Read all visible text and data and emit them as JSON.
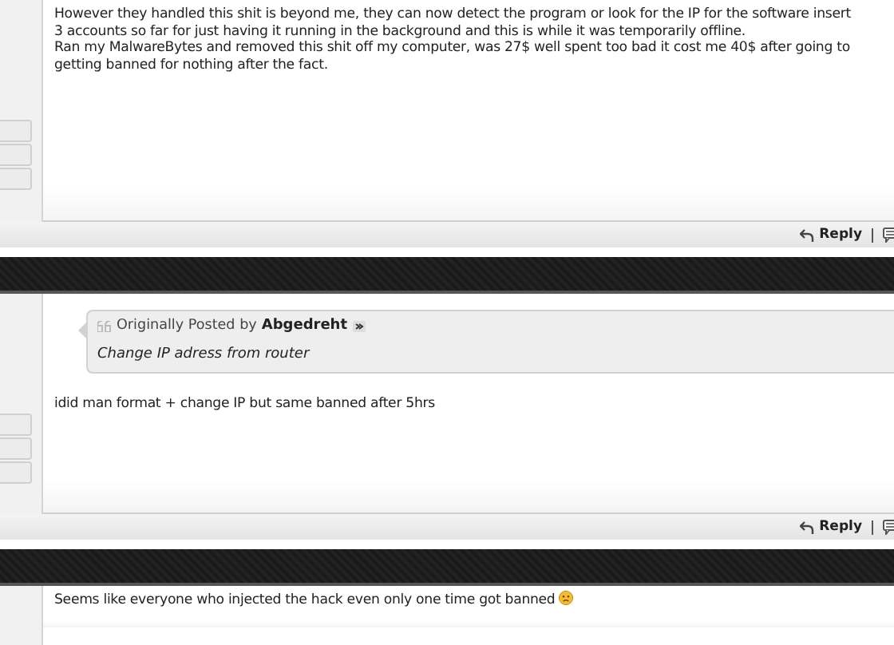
{
  "posts": [
    {
      "lines": [
        "However they handled this shit is beyond me, they can now detect the program or look for the IP for the software insert",
        "3 accounts so far for just having it running in the background and this is while it was temporarily offline.",
        "Ran my MalwareBytes and removed this shit off my computer, was 27$ well spent too bad it cost me 40$ after going to",
        "getting banned for nothing after the fact."
      ],
      "footer": {
        "reply": "Reply"
      }
    },
    {
      "quote": {
        "label": "Originally Posted by",
        "author": "Abgedreht",
        "text": "Change IP adress from router"
      },
      "lines": [
        "idid man format + change IP but same banned after 5hrs"
      ],
      "footer": {
        "reply": "Reply"
      }
    },
    {
      "lines": [
        "Seems like everyone who injected the hack even only one time got banned"
      ],
      "emoticon": true
    }
  ]
}
